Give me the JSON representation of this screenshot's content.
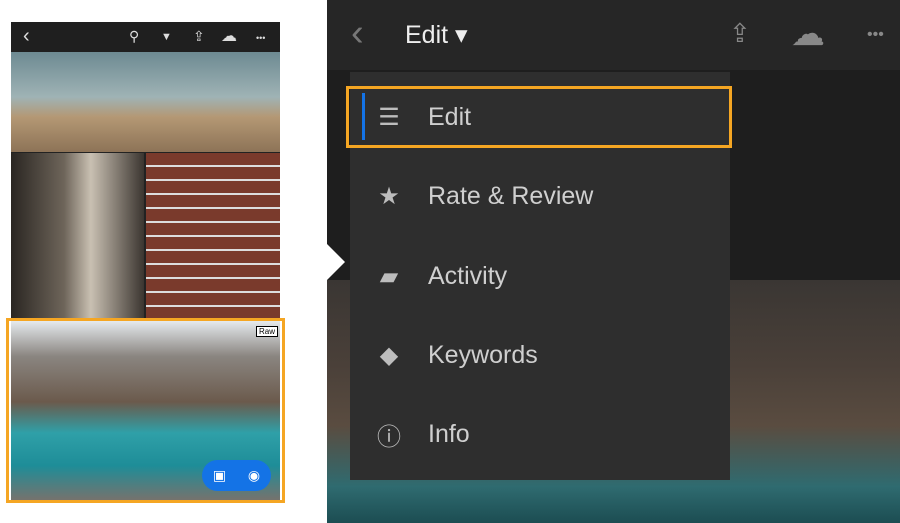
{
  "phone": {
    "toolbar": {
      "back": "‹",
      "search": "⚲",
      "filter": "▼",
      "share": "⇪",
      "cloud": "☁",
      "more": "•••"
    },
    "raw_badge": "Raw",
    "pill": {
      "add_photo": "▣",
      "camera": "◉"
    }
  },
  "header": {
    "back": "‹",
    "title": "Edit",
    "dropdown": "▾",
    "share": "⇪",
    "cloud": "☁",
    "more": "•••"
  },
  "menu": {
    "items": [
      {
        "label": "Edit",
        "icon": "sliders-icon",
        "glyph": "☰"
      },
      {
        "label": "Rate & Review",
        "icon": "star-icon",
        "glyph": "★"
      },
      {
        "label": "Activity",
        "icon": "comment-icon",
        "glyph": "▰"
      },
      {
        "label": "Keywords",
        "icon": "tag-icon",
        "glyph": "◆"
      },
      {
        "label": "Info",
        "icon": "info-icon",
        "glyph": "ⓘ"
      }
    ]
  },
  "colors": {
    "highlight": "#f5a623",
    "accent": "#1473e6"
  }
}
